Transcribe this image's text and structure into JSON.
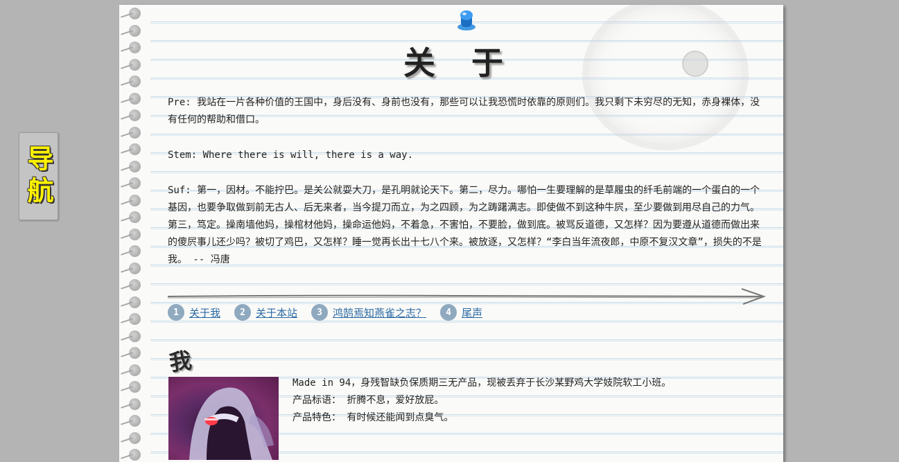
{
  "nav": {
    "label": "导航"
  },
  "about": {
    "title": "关 于",
    "pre": "Pre: 我站在一片各种价值的王国中，身后没有、身前也没有，那些可以让我恐慌时依靠的原则们。我只剩下未穷尽的无知，赤身裸体，没有任何的帮助和借口。",
    "stem": "Stem: Where there is will, there is a way.",
    "suf": "Suf: 第一，因材。不能拧巴。是关公就耍大刀，是孔明就论天下。第二，尽力。哪怕一生要理解的是草履虫的纤毛前端的一个蛋白的一个基因，也要争取做到前无古人、后无来者，当今提刀而立，为之四顾，为之踌躇满志。即使做不到这种牛屄，至少要做到用尽自己的力气。第三，笃定。操南墙他妈，操棺材他妈，操命运他妈，不着急，不害怕，不要脸，做到底。被骂反道德，又怎样？因为要遵从道德而做出来的傻屄事儿还少吗？被切了鸡巴，又怎样？睡一觉再长出十七八个来。被放逐，又怎样？“李白当年流夜郎，中原不复汉文章”，损失的不是我。 -- 冯唐"
  },
  "links": [
    {
      "num": "1",
      "label": "关于我"
    },
    {
      "num": "2",
      "label": "关于本站"
    },
    {
      "num": "3",
      "label": "鸿鹄焉知燕雀之志？"
    },
    {
      "num": "4",
      "label": "尾声"
    }
  ],
  "me": {
    "heading": "我",
    "line1": "Made in 94，身残智缺负保质期三无产品，现被丢弃于长沙某野鸡大学妓院软工小班。",
    "line2": "产品标语： 折腾不息，爱好放屁。",
    "line3": "产品特色： 有时候还能闻到点臭气。"
  },
  "colors": {
    "background": "#b4b4b4",
    "paper": "#fafaf8",
    "link": "#2a6aa5",
    "nav_text": "#fff200",
    "number_badge": "#8fa9bf"
  },
  "icons": {
    "pin": "pushpin-icon",
    "arrow": "arrow-right-icon"
  }
}
